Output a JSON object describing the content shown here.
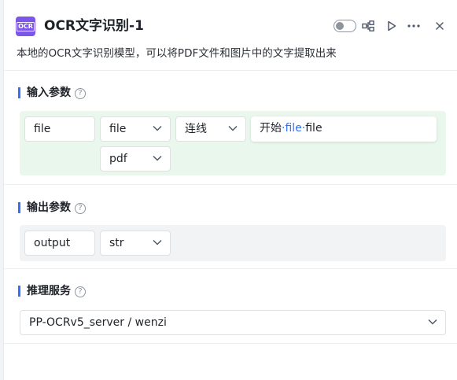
{
  "header": {
    "icon_text": "OCR",
    "title": "OCR文字识别-1",
    "description": "本地的OCR文字识别模型，可以将PDF文件和图片中的文字提取出来"
  },
  "input_params": {
    "title": "输入参数",
    "help": "?",
    "name": "file",
    "type": "file",
    "mode": "连线",
    "source_prefix": "开始",
    "source_sep1": "·",
    "source_mid": "file",
    "source_sep2": "·",
    "source_tail": "file",
    "format": "pdf"
  },
  "output_params": {
    "title": "输出参数",
    "help": "?",
    "name": "output",
    "type": "str"
  },
  "inference": {
    "title": "推理服务",
    "help": "?",
    "service": "PP-OCRv5_server / wenzi"
  },
  "colors": {
    "accent": "#3370ff",
    "icon_bg": "#7b56e8",
    "input_area_bg": "#eaf7ec",
    "output_area_bg": "#f2f3f5"
  }
}
